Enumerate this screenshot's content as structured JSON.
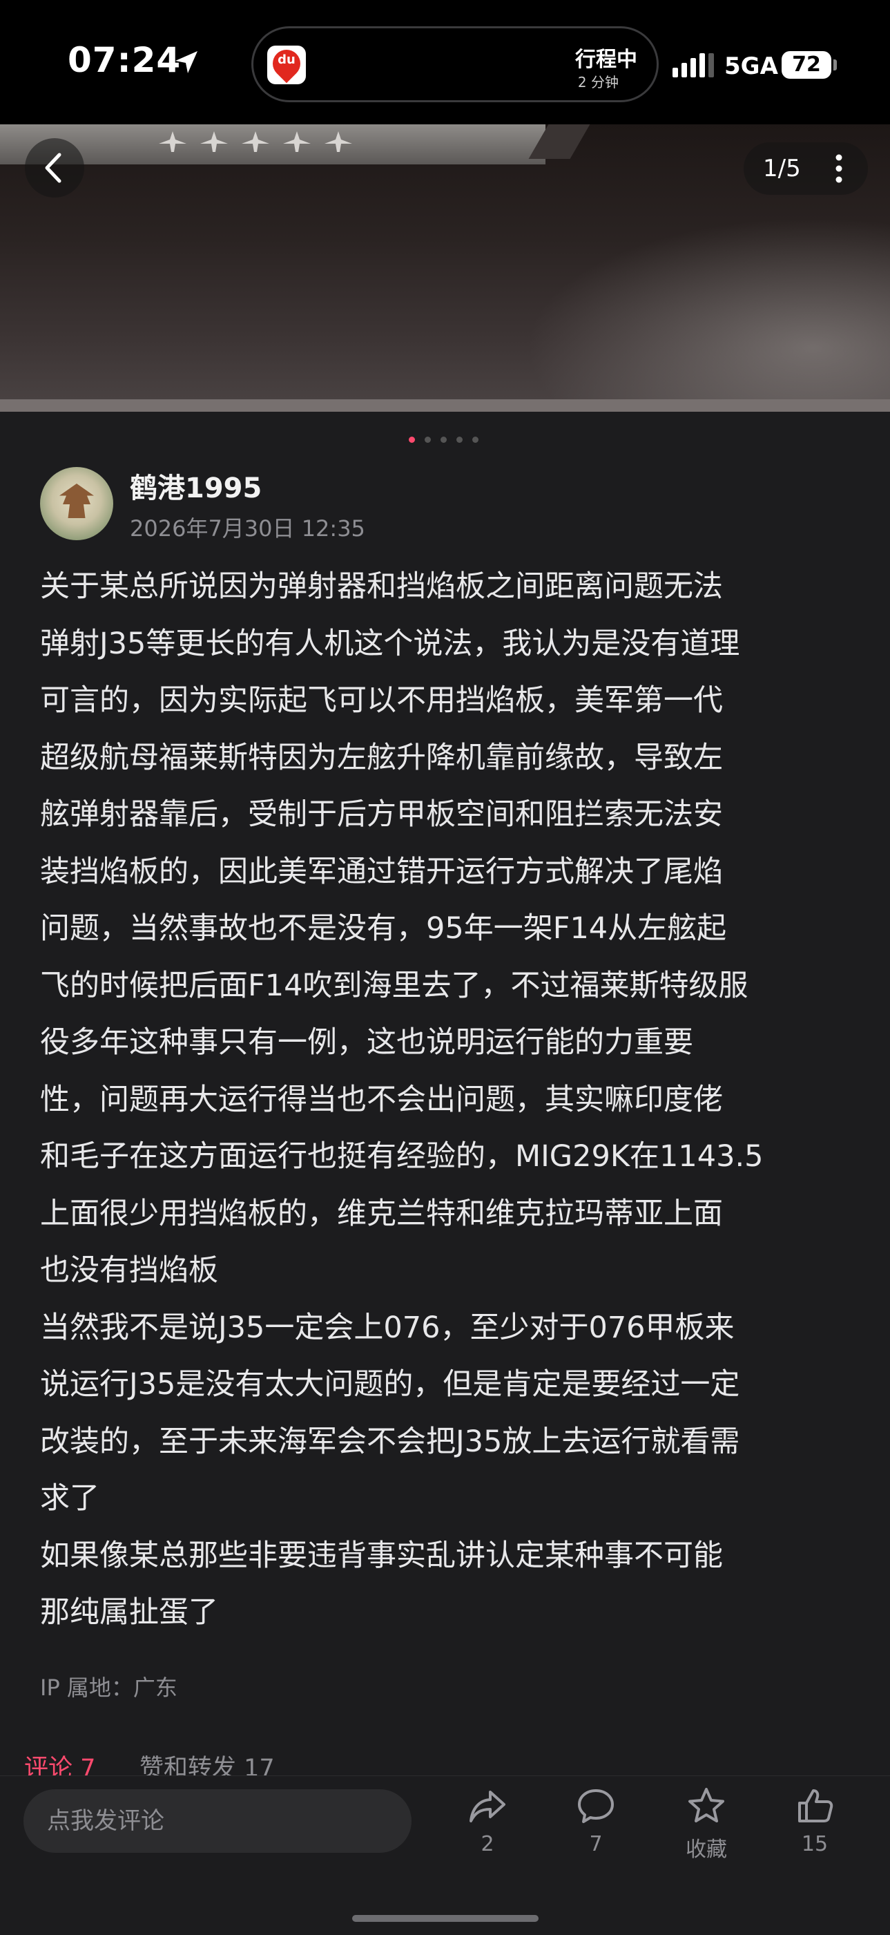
{
  "status_bar": {
    "time": "07:24",
    "trip_status": "行程中",
    "trip_eta": "2 分钟",
    "network": "5GA",
    "battery": "72",
    "app_icon_text": "du"
  },
  "gallery": {
    "counter": "1/5",
    "current_index": 1,
    "total": 5
  },
  "author": {
    "name": "鹤港1995",
    "date": "2026年7月30日 12:35"
  },
  "post": {
    "lines": [
      "关于某总所说因为弹射器和挡焰板之间距离问题无法",
      "弹射J35等更长的有人机这个说法，我认为是没有道理",
      "可言的，因为实际起飞可以不用挡焰板，美军第一代",
      "超级航母福莱斯特因为左舷升降机靠前缘故，导致左",
      "舷弹射器靠后，受制于后方甲板空间和阻拦索无法安",
      "装挡焰板的，因此美军通过错开运行方式解决了尾焰",
      "问题，当然事故也不是没有，95年一架F14从左舷起",
      "飞的时候把后面F14吹到海里去了，不过福莱斯特级服",
      "役多年这种事只有一例，这也说明运行能的力重要",
      "性，问题再大运行得当也不会出问题，其实嘛印度佬",
      "和毛子在这方面运行也挺有经验的，MIG29K在1143.5",
      "上面很少用挡焰板的，维克兰特和维克拉玛蒂亚上面",
      "也没有挡焰板",
      "当然我不是说J35一定会上076，至少对于076甲板来",
      "说运行J35是没有太大问题的，但是肯定是要经过一定",
      "改装的，至于未来海军会不会把J35放上去运行就看需",
      "求了",
      "如果像某总那些非要违背事实乱讲认定某种事不可能",
      "那纯属扯蛋了"
    ],
    "ip_location": "IP 属地：广东"
  },
  "tabs": {
    "comments": "评论 7",
    "likes_shares": "赞和转发 17"
  },
  "bottom_bar": {
    "comment_placeholder": "点我发评论",
    "share_count": "2",
    "comment_count": "7",
    "favorite_label": "收藏",
    "like_count": "15"
  },
  "colors": {
    "accent": "#ff4a6e",
    "background": "#1c1c1e",
    "muted_text": "#8e8e93"
  },
  "icons": [
    "location-arrow-icon",
    "signal-icon",
    "back-chevron-icon",
    "more-dots-icon",
    "share-icon",
    "comment-icon",
    "star-icon",
    "thumbs-up-icon"
  ]
}
